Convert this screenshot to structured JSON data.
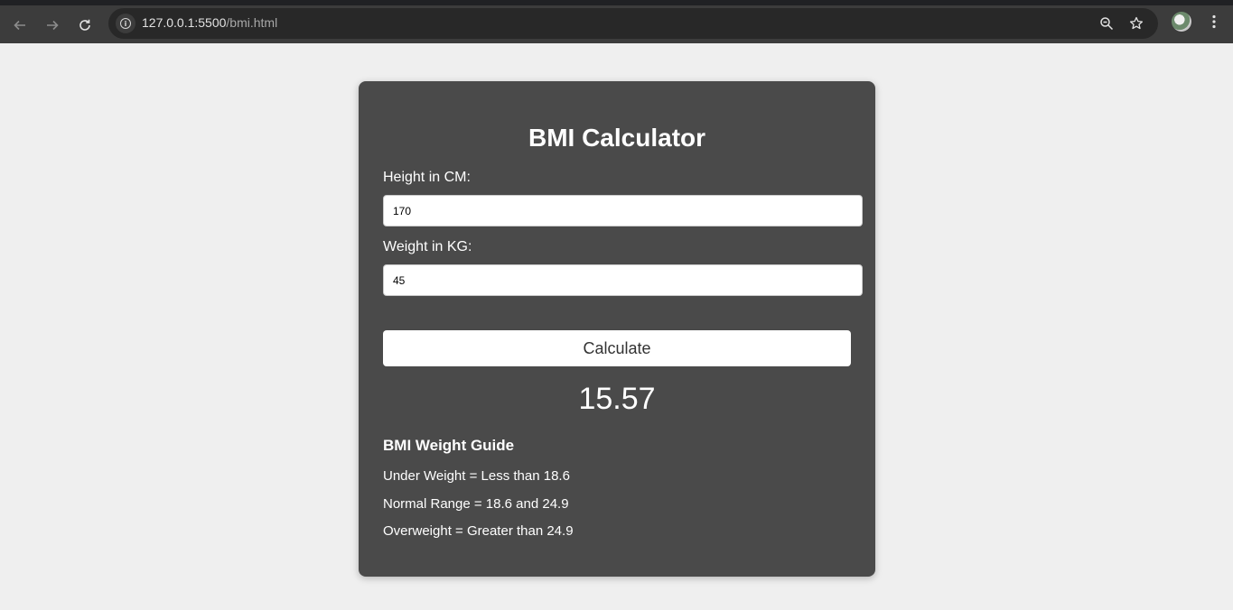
{
  "browser": {
    "url_host": "127.0.0.1:5500",
    "url_path": "/bmi.html",
    "icons": [
      "back-icon",
      "forward-icon",
      "reload-icon",
      "info-icon",
      "zoom-icon",
      "star-icon",
      "avatar",
      "menu-icon"
    ]
  },
  "app": {
    "title": "BMI Calculator",
    "height_label": "Height in CM:",
    "height_value": "170",
    "weight_label": "Weight in KG:",
    "weight_value": "45",
    "calculate_label": "Calculate",
    "result": "15.57"
  },
  "guide": {
    "title": "BMI Weight Guide",
    "lines": [
      "Under Weight = Less than 18.6",
      "Normal Range = 18.6 and 24.9",
      "Overweight = Greater than 24.9"
    ]
  },
  "colors": {
    "page_bg": "#efefef",
    "card_bg": "#4a4a4a",
    "text": "#ffffff",
    "chrome_bg": "#3c3c3c"
  }
}
